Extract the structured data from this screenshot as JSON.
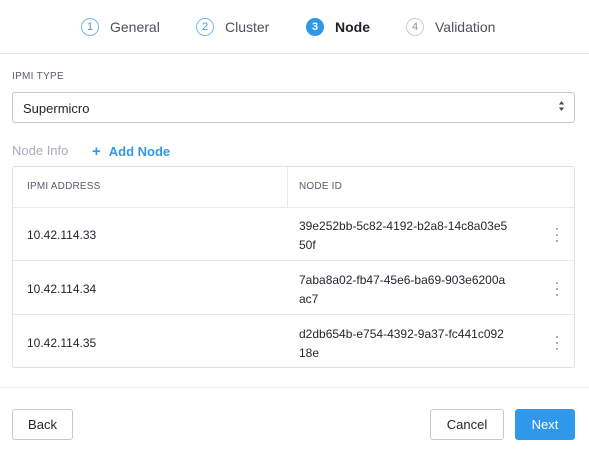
{
  "stepper": {
    "steps": [
      {
        "num": "1",
        "label": "General",
        "state": "done"
      },
      {
        "num": "2",
        "label": "Cluster",
        "state": "done"
      },
      {
        "num": "3",
        "label": "Node",
        "state": "active"
      },
      {
        "num": "4",
        "label": "Validation",
        "state": "inactive"
      }
    ]
  },
  "ipmi": {
    "label": "IPMI TYPE",
    "value": "Supermicro"
  },
  "nodes": {
    "section_label": "Node Info",
    "add_label": "Add Node",
    "add_icon": "+",
    "columns": {
      "address": "IPMI ADDRESS",
      "node_id": "NODE ID"
    },
    "rows": [
      {
        "address": "10.42.114.33",
        "node_id": "39e252bb-5c82-4192-b2a8-14c8a03e550f"
      },
      {
        "address": "10.42.114.34",
        "node_id": "7aba8a02-fb47-45e6-ba69-903e6200aac7"
      },
      {
        "address": "10.42.114.35",
        "node_id": "d2db654b-e754-4392-9a37-fc441c09218e"
      }
    ]
  },
  "footer": {
    "back_label": "Back",
    "cancel_label": "Cancel",
    "next_label": "Next"
  },
  "colors": {
    "accent": "#2f98ea",
    "border": "#c4c9d0",
    "muted_text": "#a7adb5"
  }
}
